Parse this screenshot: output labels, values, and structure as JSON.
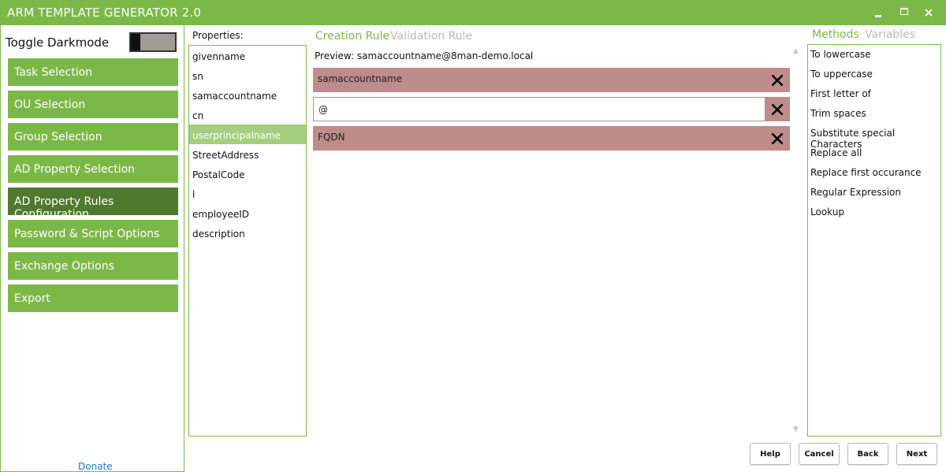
{
  "window": {
    "title": "ARM TEMPLATE GENERATOR 2.0",
    "controls": [
      "minimize-icon",
      "maximize-icon",
      "close-icon"
    ]
  },
  "sidebar": {
    "darkmode_label": "Toggle Darkmode",
    "darkmode_on": false,
    "items": [
      {
        "label": "Task Selection",
        "active": false
      },
      {
        "label": "OU Selection",
        "active": false
      },
      {
        "label": "Group Selection",
        "active": false
      },
      {
        "label": "AD Property Selection",
        "active": false
      },
      {
        "label": "AD Property Rules Configuration",
        "active": true
      },
      {
        "label": "Password & Script Options",
        "active": false
      },
      {
        "label": "Exchange Options",
        "active": false
      },
      {
        "label": "Export",
        "active": false
      }
    ],
    "donate": "Donate"
  },
  "properties": {
    "label": "Properties:",
    "items": [
      "givenname",
      "sn",
      "samaccountname",
      "cn",
      "userprincipalname",
      "StreetAddress",
      "PostalCode",
      "l",
      "employeeID",
      "description"
    ],
    "selected": "userprincipalname"
  },
  "rules": {
    "tabs": [
      {
        "label": "Creation Rule",
        "active": true
      },
      {
        "label": "Validation Rule",
        "active": false
      }
    ],
    "preview": "Preview: samaccountname@8man-demo.local",
    "parts": [
      {
        "type": "variable",
        "text": "samaccountname"
      },
      {
        "type": "text",
        "text": "@"
      },
      {
        "type": "variable",
        "text": "FQDN"
      }
    ],
    "scroll_icons": [
      "scroll-up-icon",
      "scroll-down-icon"
    ]
  },
  "methods": {
    "tabs": [
      {
        "label": "Methods",
        "active": true
      },
      {
        "label": "Variables",
        "active": false
      }
    ],
    "items": [
      "To lowercase",
      "To uppercase",
      "First letter of",
      "Trim spaces",
      "Substitute special Characters",
      "Replace all",
      "Replace first occurance",
      "Regular Expression",
      "Lookup"
    ]
  },
  "footer": {
    "help": "Help",
    "cancel": "Cancel",
    "back": "Back",
    "next": "Next"
  },
  "colors": {
    "accent": "#7cb848",
    "nav_active": "#4f7a2e",
    "selected_item": "#a4cf7e",
    "rule_variable": "#bd8c8b",
    "tab_inactive": "#b9b9b9",
    "link": "#1f73c9"
  }
}
